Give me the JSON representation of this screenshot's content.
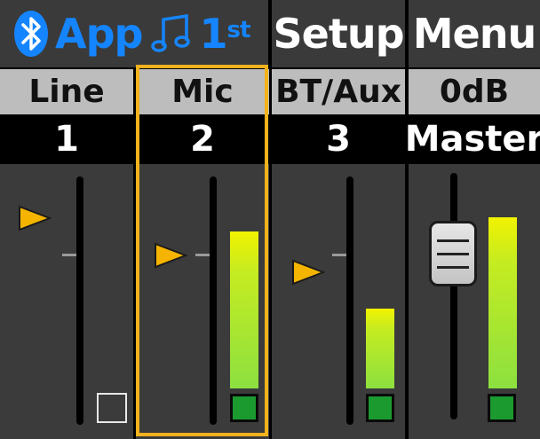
{
  "header": {
    "app_label": "App",
    "first_label": "1",
    "first_suffix": "st",
    "setup_label": "Setup",
    "menu_label": "Menu"
  },
  "channels": [
    {
      "name": "Line",
      "number": "1",
      "fader_level": 0.84,
      "meter_level": 0.0,
      "signal_active": false
    },
    {
      "name": "Mic",
      "number": "2",
      "fader_level": 0.66,
      "meter_level": 0.65,
      "signal_active": true,
      "selected": true
    },
    {
      "name": "BT/Aux",
      "number": "3",
      "fader_level": 0.55,
      "meter_level": 0.32,
      "signal_active": true
    }
  ],
  "master": {
    "gain_label": "0dB",
    "name": "Master",
    "fader_level": 0.74,
    "meter_level": 0.7,
    "signal_active": true
  },
  "colors": {
    "accent_blue": "#1585ff",
    "selection_orange": "#f2b21c",
    "marker_orange": "#f4b400",
    "clip_green": "#1b9a2f",
    "meter_top": "#f2f200",
    "meter_bottom": "#8ce040"
  },
  "icons": {
    "bluetooth": "bluetooth-icon",
    "music_note": "music-note-icon"
  }
}
